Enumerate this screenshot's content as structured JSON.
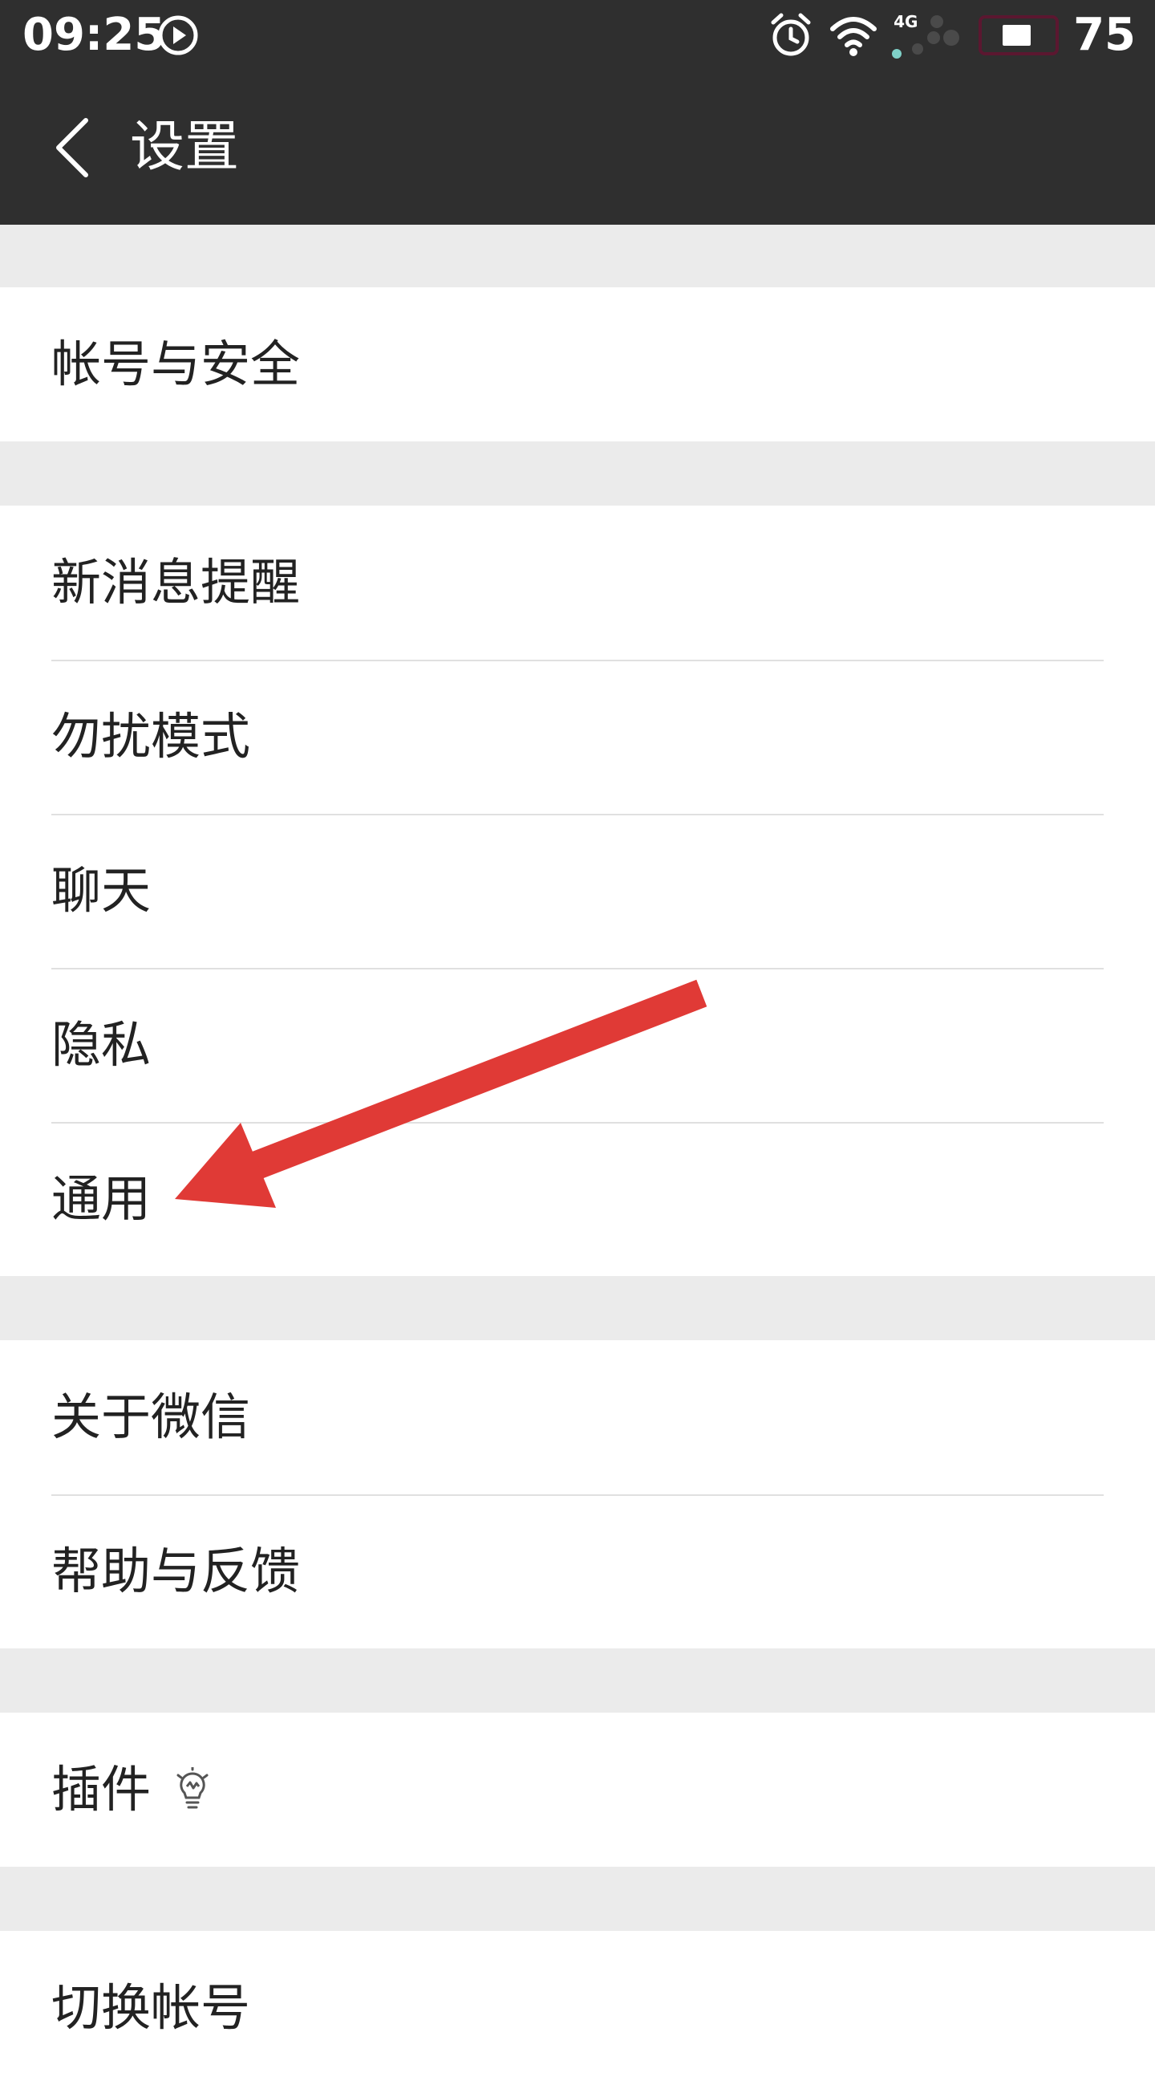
{
  "status_bar": {
    "time": "09:25",
    "network": "4G",
    "battery_level": "75",
    "battery_percent": 75,
    "play_icon": "play-circle-icon",
    "alarm_icon": "alarm-icon",
    "wifi_icon": "wifi-icon",
    "signal_icon": "signal-icon"
  },
  "nav": {
    "title": "设置",
    "back_icon": "chevron-left-icon"
  },
  "groups": [
    {
      "items": [
        {
          "label": "帐号与安全"
        }
      ]
    },
    {
      "items": [
        {
          "label": "新消息提醒"
        },
        {
          "label": "勿扰模式"
        },
        {
          "label": "聊天"
        },
        {
          "label": "隐私"
        },
        {
          "label": "通用"
        }
      ]
    },
    {
      "items": [
        {
          "label": "关于微信"
        },
        {
          "label": "帮助与反馈"
        }
      ]
    },
    {
      "items": [
        {
          "label": "插件",
          "icon": "lightbulb-icon"
        }
      ]
    },
    {
      "items": [
        {
          "label": "切换帐号"
        }
      ]
    }
  ],
  "colors": {
    "header_bg": "#2f2f2f",
    "page_bg": "#ebebeb",
    "row_bg": "#ffffff",
    "divider": "#e0e0e0",
    "annotation_arrow": "#e03a36"
  }
}
